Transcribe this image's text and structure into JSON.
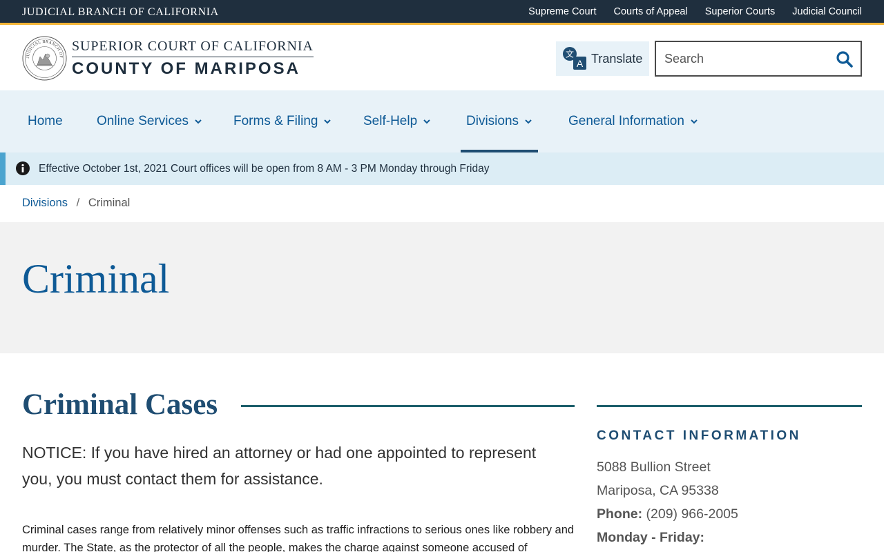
{
  "topbar": {
    "brand": "JUDICIAL BRANCH OF CALIFORNIA",
    "links": [
      "Supreme Court",
      "Courts of Appeal",
      "Superior Courts",
      "Judicial Council"
    ]
  },
  "header": {
    "court_line1": "SUPERIOR COURT OF CALIFORNIA",
    "court_line2": "COUNTY OF MARIPOSA",
    "seal_text": "JUDICIAL BRANCH OF CALIFORNIA",
    "translate_label": "Translate",
    "search_placeholder": "Search"
  },
  "nav": {
    "items": [
      {
        "label": "Home",
        "has_dropdown": false
      },
      {
        "label": "Online Services",
        "has_dropdown": true
      },
      {
        "label": "Forms & Filing",
        "has_dropdown": true
      },
      {
        "label": "Self-Help",
        "has_dropdown": true
      },
      {
        "label": "Divisions",
        "has_dropdown": true,
        "active": true
      },
      {
        "label": "General Information",
        "has_dropdown": true
      }
    ]
  },
  "alert": {
    "text": "Effective October 1st, 2021 Court offices will be open from 8 AM - 3 PM Monday through Friday",
    "icon": "info-icon"
  },
  "breadcrumb": {
    "parent": "Divisions",
    "separator": "/",
    "current": "Criminal"
  },
  "hero": {
    "title": "Criminal"
  },
  "content": {
    "section_title": "Criminal Cases",
    "notice": "NOTICE: If you have hired an attorney or had one appointed to represent you, you must contact them for assistance.",
    "body": "Criminal cases range from relatively minor offenses such as traffic infractions to serious ones like robbery and murder. The State, as the protector of all the people, makes the charge against someone accused of committing"
  },
  "sidebar": {
    "heading": "CONTACT INFORMATION",
    "address_line1": "5088 Bullion Street",
    "address_line2": "Mariposa, CA 95338",
    "phone_label": "Phone:",
    "phone_value": "(209) 966-2005",
    "hours_label": "Monday - Friday:"
  },
  "colors": {
    "topbar_bg": "#1f2f3e",
    "accent_gold": "#f3b535",
    "link_blue": "#0e5a96",
    "nav_bg": "#e8f2f8",
    "alert_bg": "#dcedf5",
    "alert_border": "#4ba4cf",
    "hero_bg": "#f2f2f2",
    "rule_teal": "#1d5f6b"
  }
}
